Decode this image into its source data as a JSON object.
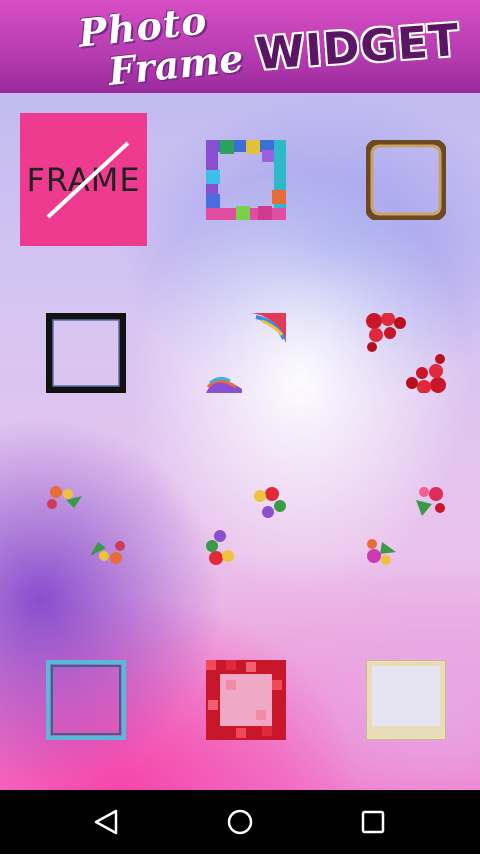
{
  "header": {
    "title_line1": "Photo",
    "title_line2": "Frame",
    "title_badge": "WIDGET"
  },
  "frames": [
    {
      "id": "no-frame",
      "label": "FRAME"
    },
    {
      "id": "colorful-blocks"
    },
    {
      "id": "bronze-ornate"
    },
    {
      "id": "black-glossy"
    },
    {
      "id": "rainbow-corners"
    },
    {
      "id": "red-hearts-corners"
    },
    {
      "id": "flower-corners"
    },
    {
      "id": "balloon-corners"
    },
    {
      "id": "floral-bouquet-corners"
    },
    {
      "id": "blue-double-border"
    },
    {
      "id": "red-pixel-border"
    },
    {
      "id": "beige-polaroid"
    }
  ],
  "navbar": {
    "back": "back-icon",
    "home": "home-icon",
    "recents": "recents-icon"
  },
  "colors": {
    "header": "#c443b8",
    "no_frame_tile": "#ee3b8f"
  }
}
